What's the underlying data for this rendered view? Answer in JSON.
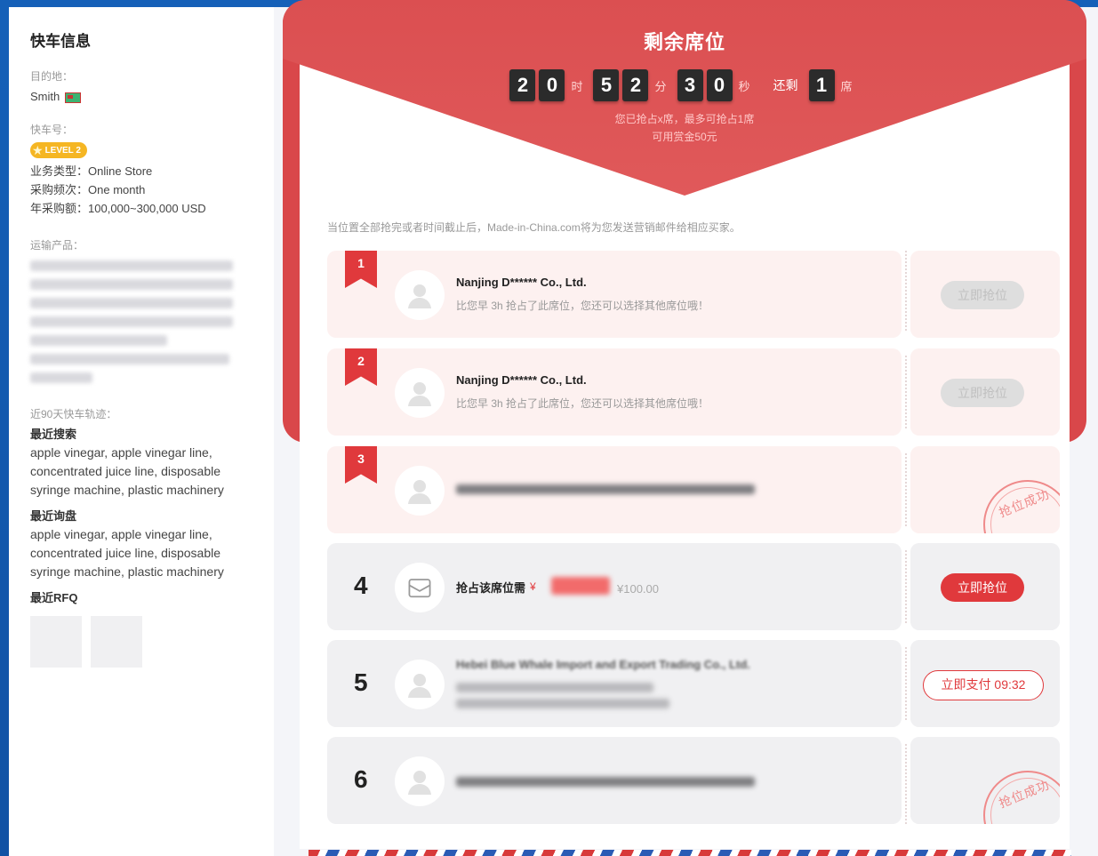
{
  "sidebar": {
    "title": "快车信息",
    "destination_label": "目的地：",
    "destination_value": "Smith",
    "member_label": "快车号：",
    "level_badge": "LEVEL 2",
    "business_type_label": "业务类型：",
    "business_type_value": "Online Store",
    "purchase_freq_label": "采购频次：",
    "purchase_freq_value": "One month",
    "annual_purchase_label": "年采购额：",
    "annual_purchase_value": "100,000~300,000 USD",
    "products_label": "运输产品：",
    "track_label": "近90天快车轨迹：",
    "recent_search_label": "最近搜索",
    "recent_search_text": "apple vinegar, apple vinegar line, concentrated juice line, disposable syringe machine, plastic machinery",
    "recent_browse_label": "最近询盘",
    "recent_browse_text": "apple vinegar, apple vinegar line, concentrated juice line, disposable syringe machine, plastic machinery",
    "recent_rfq_label": "最近RFQ"
  },
  "header": {
    "title": "剩余席位",
    "countdown": {
      "hours": [
        "2",
        "0"
      ],
      "hours_unit": "时",
      "minutes": [
        "5",
        "2"
      ],
      "minutes_unit": "分",
      "seconds": [
        "3",
        "0"
      ],
      "seconds_unit": "秒",
      "remaining_label": "还剩",
      "remaining": "1",
      "remaining_unit": "席"
    },
    "note_line1": "您已抢占x席，最多可抢占1席",
    "note_line2": "可用赏金50元"
  },
  "notice": "当位置全部抢完或者时间截止后，Made-in-China.com将为您发送营销邮件给相应买家。",
  "seats": [
    {
      "rank": "1",
      "company": "Nanjing D****** Co., Ltd.",
      "desc": "比您早 3h 抢占了此席位，您还可以选择其他席位哦！",
      "action": "立即抢位"
    },
    {
      "rank": "2",
      "company": "Nanjing D****** Co., Ltd.",
      "desc": "比您早 3h 抢占了此席位，您还可以选择其他席位哦！",
      "action": "立即抢位"
    },
    {
      "rank": "3",
      "stamp": "抢位成功"
    },
    {
      "rank": "4",
      "label": "抢占该席位需",
      "currency": "¥",
      "original_price": "¥100.00",
      "action": "立即抢位"
    },
    {
      "rank": "5",
      "company": "Hebei Blue Whale Import and Export Trading Co., Ltd.",
      "action": "立即支付 09:32"
    },
    {
      "rank": "6",
      "stamp": "抢位成功"
    }
  ],
  "colors": {
    "accent": "#e0393c",
    "envelope": "#d9474a",
    "background": "#1560b8"
  }
}
